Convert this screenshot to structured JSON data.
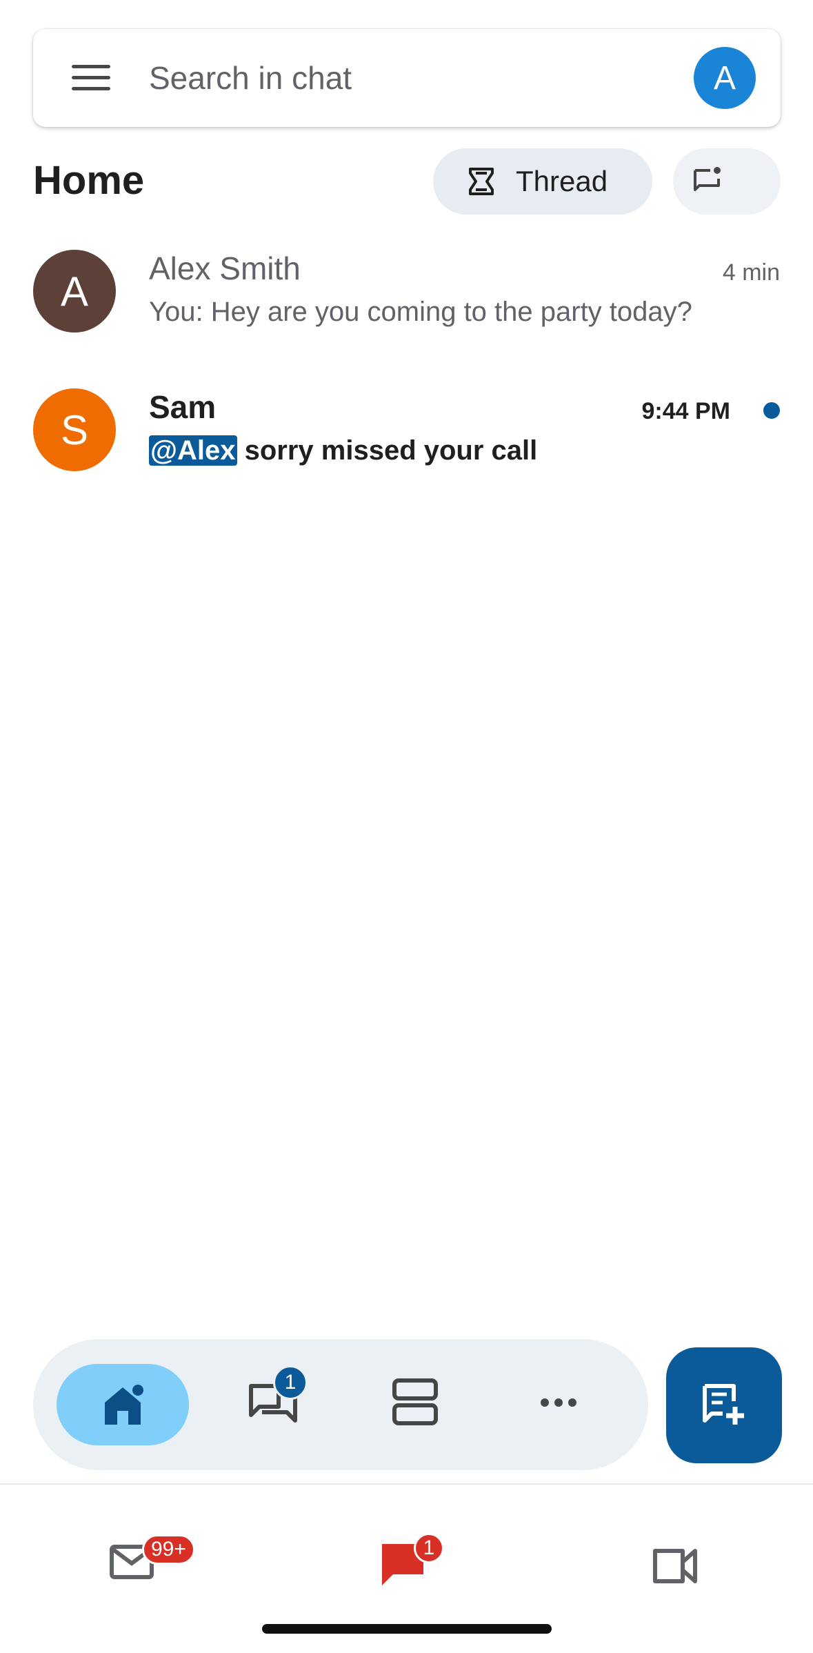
{
  "search": {
    "placeholder": "Search in chat",
    "account_initial": "A"
  },
  "header": {
    "title": "Home",
    "thread_label": "Thread"
  },
  "conversations": [
    {
      "name": "Alex Smith",
      "initial": "A",
      "time": "4 min",
      "preview": "You: Hey are you coming to the party today?",
      "avatar_color": "#5d4037",
      "unread": false
    },
    {
      "name": "Sam",
      "initial": "S",
      "time": "9:44 PM",
      "mention": "@Alex",
      "preview": " sorry missed your call",
      "avatar_color": "#ef6c00",
      "unread": true
    }
  ],
  "bottom_nav": {
    "items": [
      "home-icon",
      "direct-messages-icon",
      "spaces-icon",
      "more-icon"
    ],
    "dm_badge": "1"
  },
  "app_switcher": {
    "mail_badge": "99+",
    "chat_badge": "1"
  },
  "colors": {
    "accent": "#0b5a9a",
    "active_nav": "#7fcffa",
    "badge_red": "#d93025"
  }
}
